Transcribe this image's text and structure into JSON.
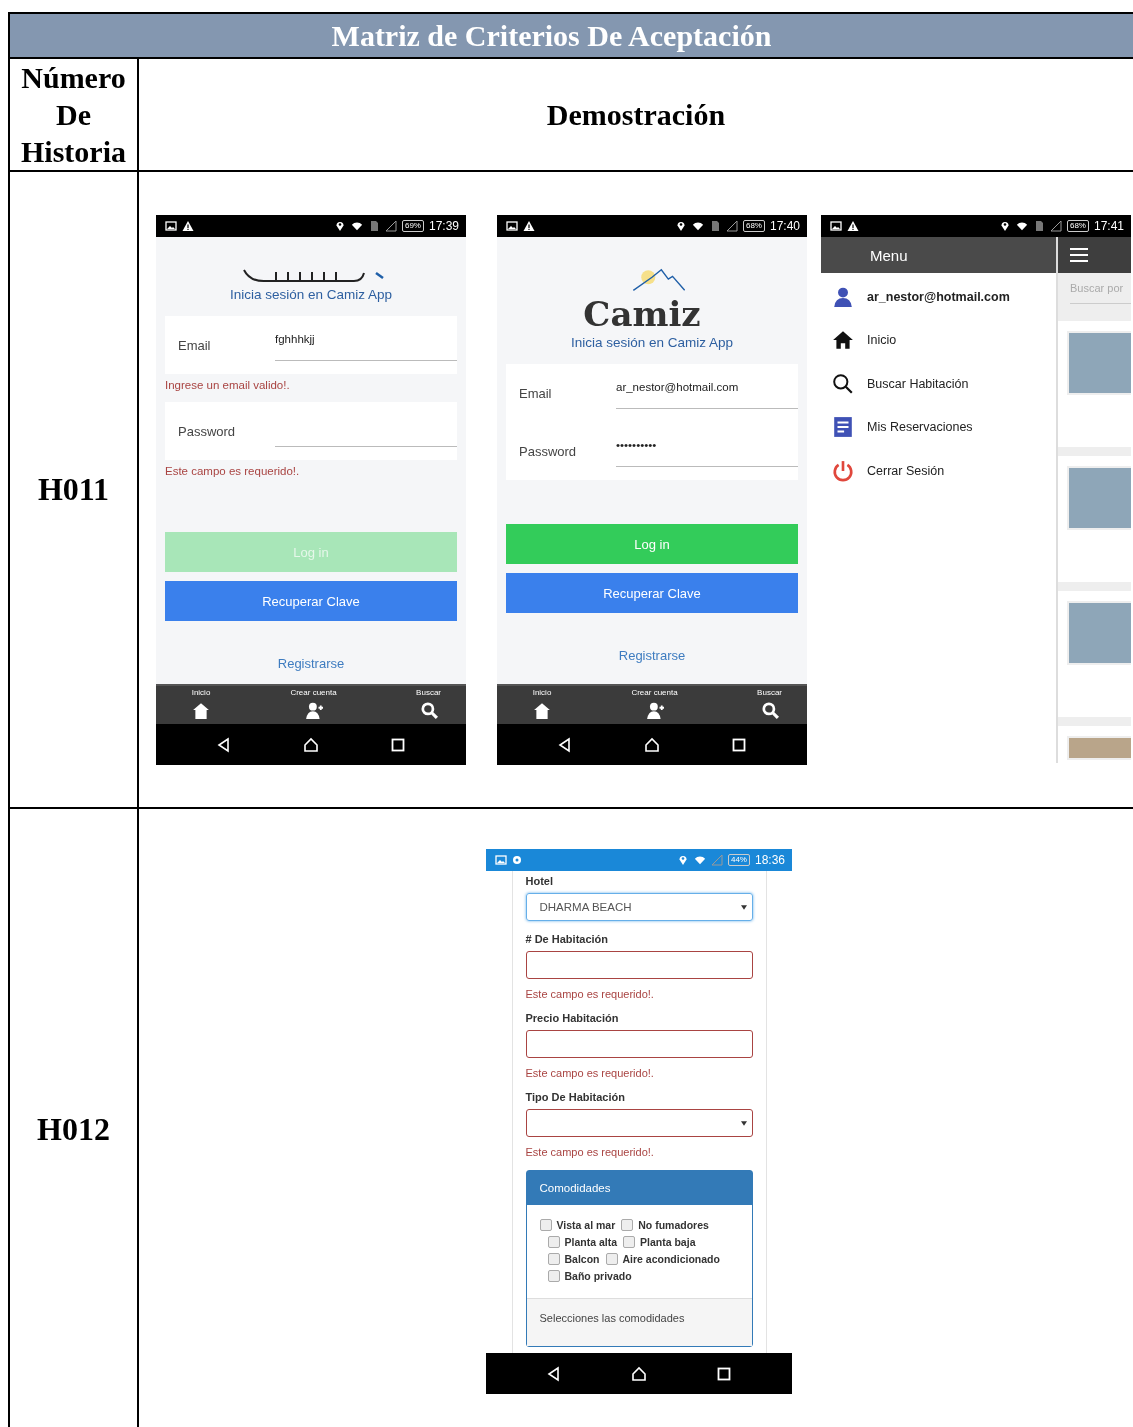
{
  "title": "Matriz de Criterios De Aceptación",
  "header": {
    "column_1": "Número De Historia",
    "column_2": "Demostración"
  },
  "rows": [
    {
      "story": "H011",
      "screens": [
        {
          "kind": "login",
          "status_bar": {
            "battery": "69%",
            "time": "17:39"
          },
          "heading": "Inicia sesión en Camiz App",
          "fields": [
            {
              "label": "Email",
              "value": "fghhhkjj",
              "error": "Ingrese un email valido!."
            },
            {
              "label": "Password",
              "error": "Este campo es requerido!."
            }
          ],
          "login_button": {
            "label": "Log in",
            "disabled": true
          },
          "recover_button": "Recuperar Clave",
          "register_link": "Registrarse",
          "bottom_tabs": [
            "Inicio",
            "Crear cuenta",
            "Buscar"
          ]
        },
        {
          "kind": "login",
          "status_bar": {
            "battery": "68%",
            "time": "17:40"
          },
          "logo_text": "Camiz",
          "heading": "Inicia sesión en Camiz App",
          "fields": [
            {
              "label": "Email",
              "value": "ar_nestor@hotmail.com"
            },
            {
              "label": "Password",
              "value": "••••••••••"
            }
          ],
          "login_button": {
            "label": "Log in",
            "disabled": false
          },
          "recover_button": "Recuperar Clave",
          "register_link": "Registrarse",
          "bottom_tabs": [
            "Inicio",
            "Crear cuenta",
            "Buscar"
          ]
        },
        {
          "kind": "menu",
          "status_bar": {
            "battery": "68%",
            "time": "17:41"
          },
          "menu_title": "Menu",
          "user": "ar_nestor@hotmail.com",
          "items": [
            "Inicio",
            "Buscar Habitación",
            "Mis Reservaciones",
            "Cerrar Sesión"
          ],
          "search": {
            "placeholder": "Buscar por"
          }
        }
      ]
    },
    {
      "story": "H012",
      "screens": [
        {
          "kind": "form",
          "status_bar": {
            "battery": "44%",
            "time": "18:36"
          },
          "fields": [
            {
              "label": "Hotel",
              "kind": "select",
              "value": "DHARMA BEACH"
            },
            {
              "label": "# De Habitación",
              "kind": "input",
              "error": "Este campo es requerido!."
            },
            {
              "label": "Precio Habitación",
              "kind": "input",
              "error": "Este campo es requerido!."
            },
            {
              "label": "Tipo De Habitación",
              "kind": "select",
              "error": "Este campo es requerido!."
            }
          ],
          "amenities": {
            "title": "Comodidades",
            "items": [
              {
                "label": "Vista al mar",
                "checked": false
              },
              {
                "label": "No fumadores",
                "checked": false
              },
              {
                "label": "Planta alta",
                "checked": false
              },
              {
                "label": "Planta baja",
                "checked": false
              },
              {
                "label": "Balcon",
                "checked": false
              },
              {
                "label": "Aire acondicionado",
                "checked": false
              },
              {
                "label": "Baño privado",
                "checked": false
              }
            ],
            "footer": "Selecciones las comodidades"
          }
        }
      ]
    }
  ]
}
